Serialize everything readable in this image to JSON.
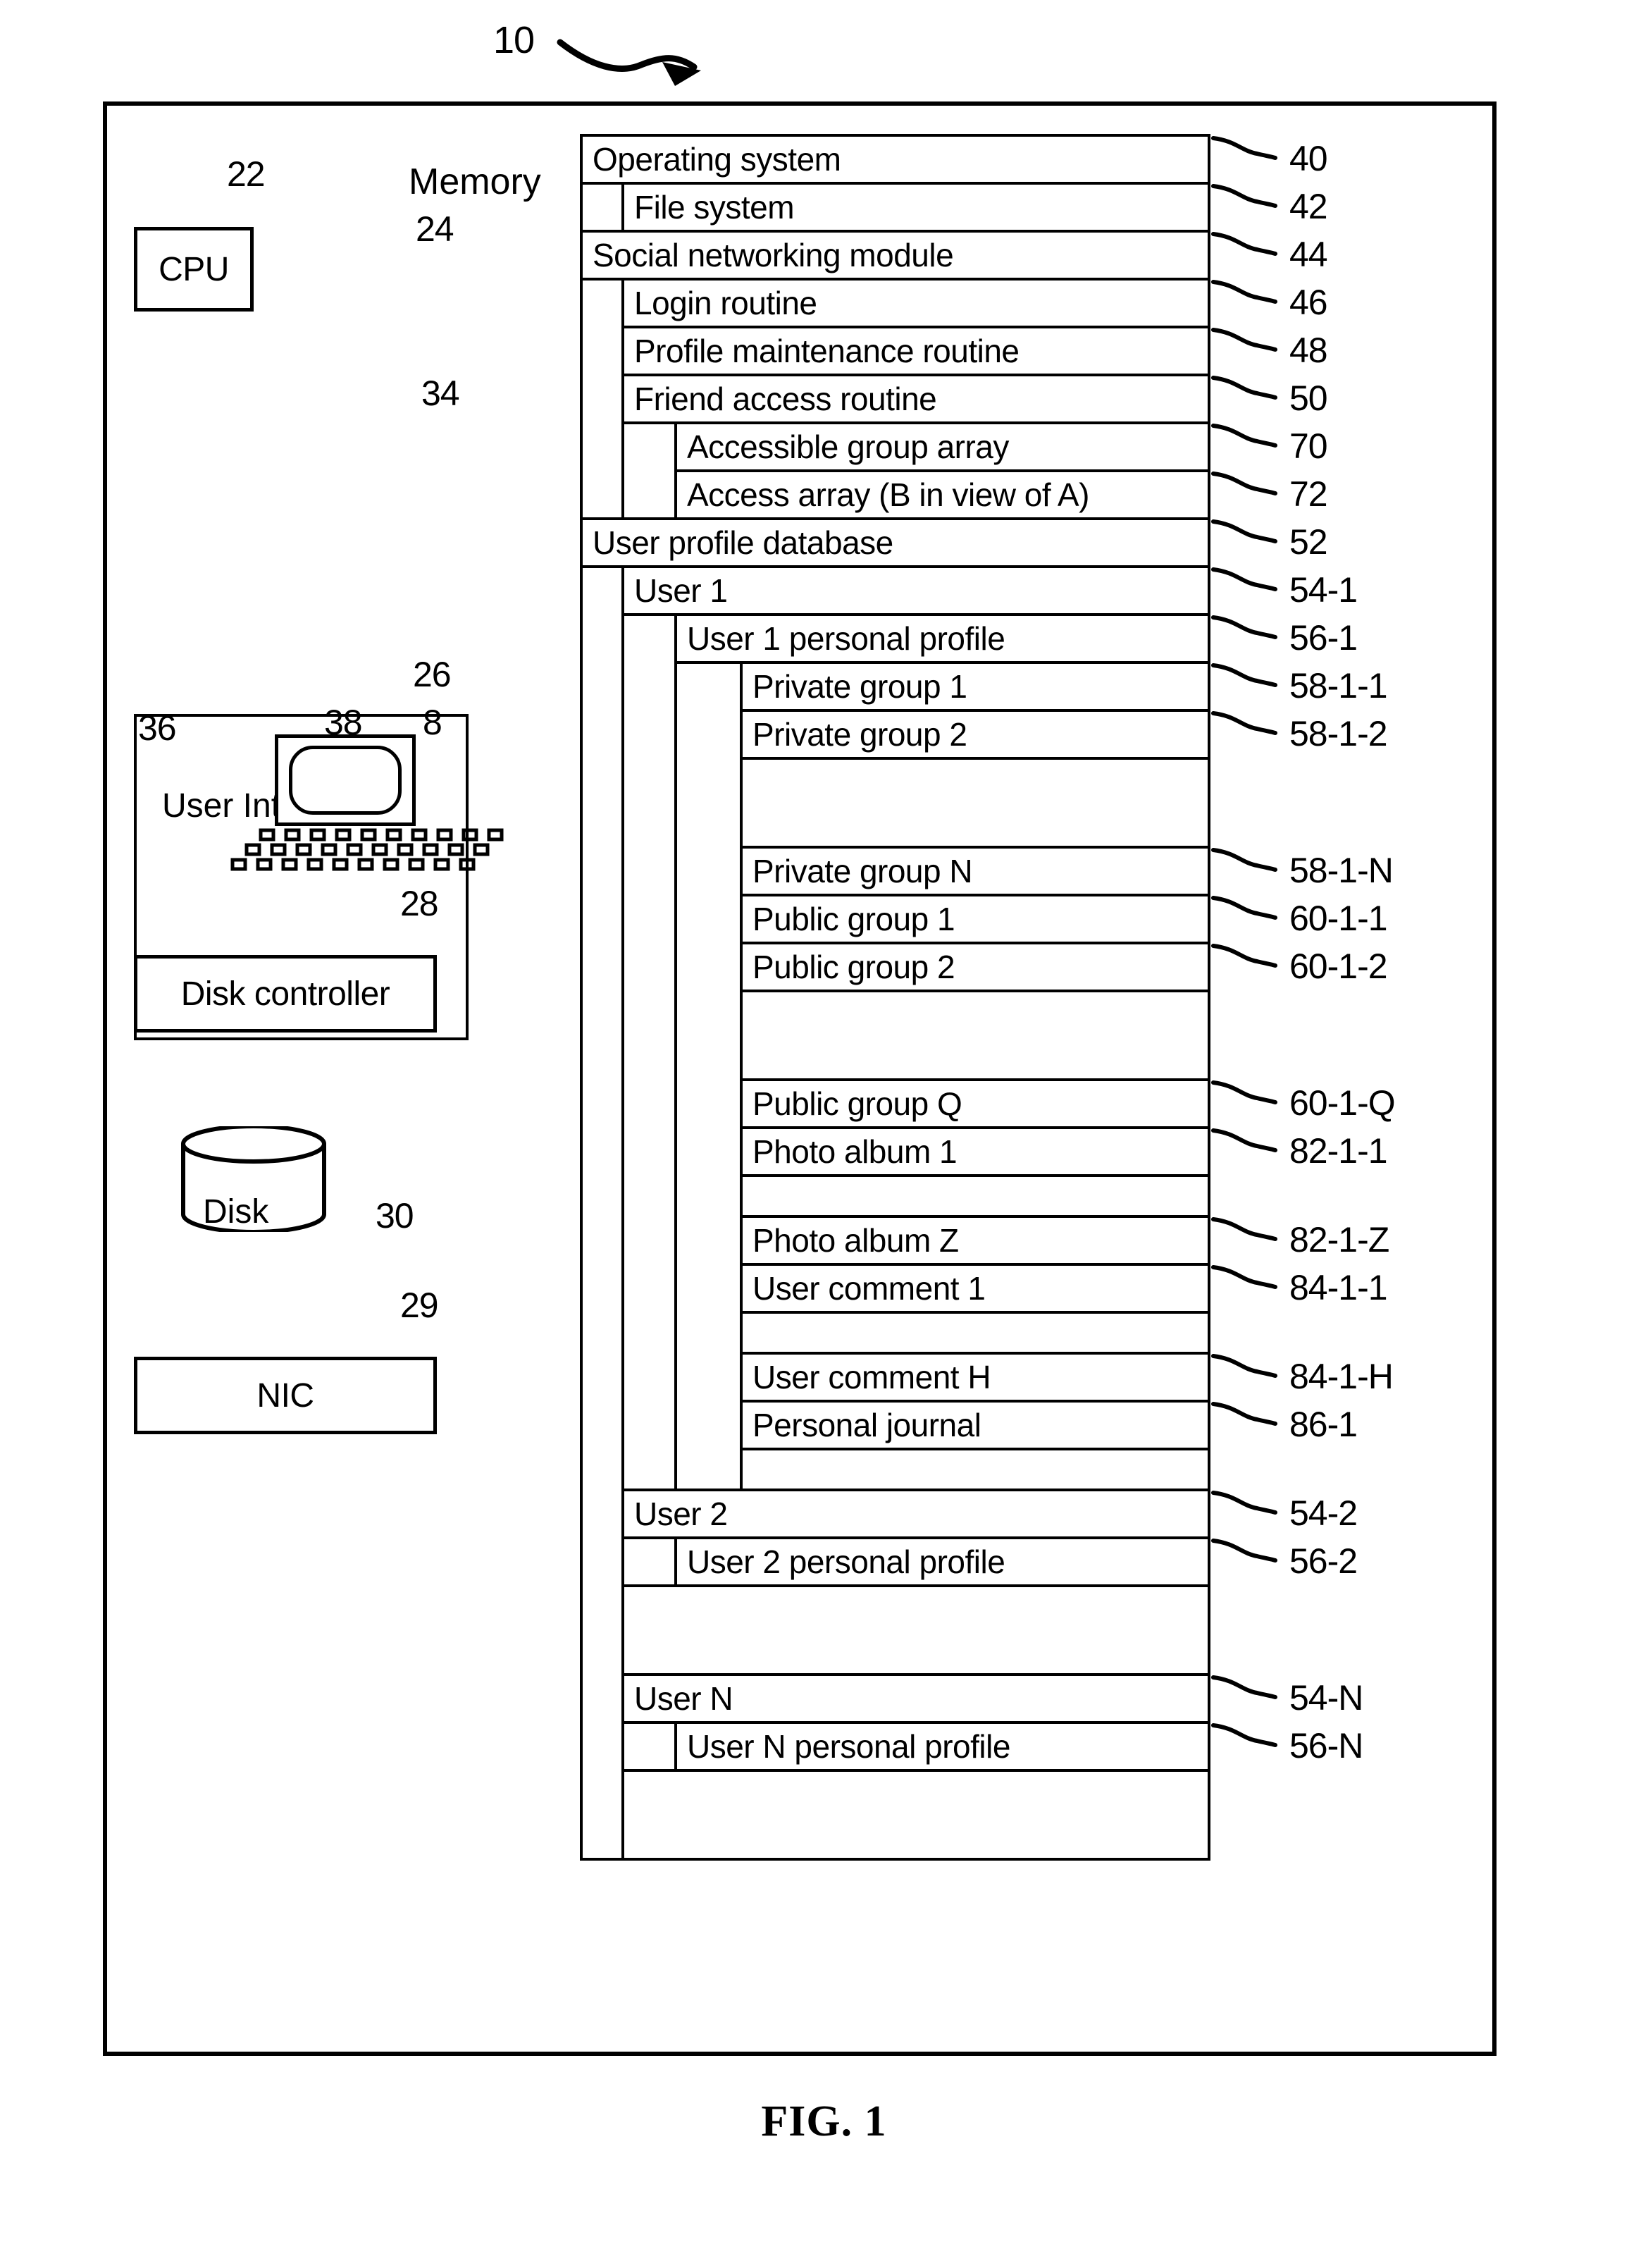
{
  "figure": {
    "caption": "FIG. 1",
    "system_ref": "10"
  },
  "left_column": {
    "cpu": {
      "label": "CPU",
      "ref": "22"
    },
    "memory": {
      "label": "Memory",
      "ref": "24"
    },
    "bus": {
      "ref": "34"
    },
    "user_interface": {
      "label": "User Interface",
      "ref": "26",
      "mouse_ref": "36",
      "display_ref": "38",
      "keyboard_ref": "8"
    },
    "disk_controller": {
      "label": "Disk controller",
      "ref": "28"
    },
    "disk": {
      "label": "Disk",
      "ref": "30"
    },
    "nic": {
      "label": "NIC",
      "ref": "29"
    }
  },
  "memory_contents": [
    {
      "label": "Operating system",
      "ref": "40",
      "level": 0
    },
    {
      "label": "File system",
      "ref": "42",
      "level": 1
    },
    {
      "label": "Social networking module",
      "ref": "44",
      "level": 0
    },
    {
      "label": "Login routine",
      "ref": "46",
      "level": 1
    },
    {
      "label": "Profile maintenance routine",
      "ref": "48",
      "level": 1
    },
    {
      "label": "Friend access routine",
      "ref": "50",
      "level": 1
    },
    {
      "label": "Accessible group array",
      "ref": "70",
      "level": 2
    },
    {
      "label": "Access array (B in view of A)",
      "ref": "72",
      "level": 2
    },
    {
      "label": "User profile database",
      "ref": "52",
      "level": 0
    },
    {
      "label": "User 1",
      "ref": "54-1",
      "level": 1
    },
    {
      "label": "User 1 personal profile",
      "ref": "56-1",
      "level": 2
    },
    {
      "label": "Private group 1",
      "ref": "58-1-1",
      "level": 3
    },
    {
      "label": "Private group 2",
      "ref": "58-1-2",
      "level": 3
    },
    {
      "label": "",
      "ref": "",
      "level": 3,
      "dots": "vertical"
    },
    {
      "label": "Private group N",
      "ref": "58-1-N",
      "level": 3
    },
    {
      "label": "Public group 1",
      "ref": "60-1-1",
      "level": 3
    },
    {
      "label": "Public group 2",
      "ref": "60-1-2",
      "level": 3
    },
    {
      "label": "",
      "ref": "",
      "level": 3,
      "dots": "vertical"
    },
    {
      "label": "Public group Q",
      "ref": "60-1-Q",
      "level": 3
    },
    {
      "label": "Photo album 1",
      "ref": "82-1-1",
      "level": 3
    },
    {
      "label": "",
      "ref": "",
      "level": 3,
      "dots": "horizontal"
    },
    {
      "label": "Photo album Z",
      "ref": "82-1-Z",
      "level": 3
    },
    {
      "label": "User comment 1",
      "ref": "84-1-1",
      "level": 3
    },
    {
      "label": "",
      "ref": "",
      "level": 3,
      "dots": "horizontal"
    },
    {
      "label": "User comment H",
      "ref": "84-1-H",
      "level": 3
    },
    {
      "label": "Personal journal",
      "ref": "86-1",
      "level": 3
    },
    {
      "label": "",
      "ref": "",
      "level": 3,
      "dots": "horizontal"
    },
    {
      "label": "User 2",
      "ref": "54-2",
      "level": 1
    },
    {
      "label": "User 2 personal profile",
      "ref": "56-2",
      "level": 2
    },
    {
      "label": "",
      "ref": "",
      "level": 1,
      "dots": "vertical"
    },
    {
      "label": "User N",
      "ref": "54-N",
      "level": 1
    },
    {
      "label": "User N personal profile",
      "ref": "56-N",
      "level": 2
    },
    {
      "label": "",
      "ref": "",
      "level": 1,
      "dots": "vertical"
    }
  ],
  "colors": {
    "ink": "#000000",
    "paper": "#ffffff"
  }
}
